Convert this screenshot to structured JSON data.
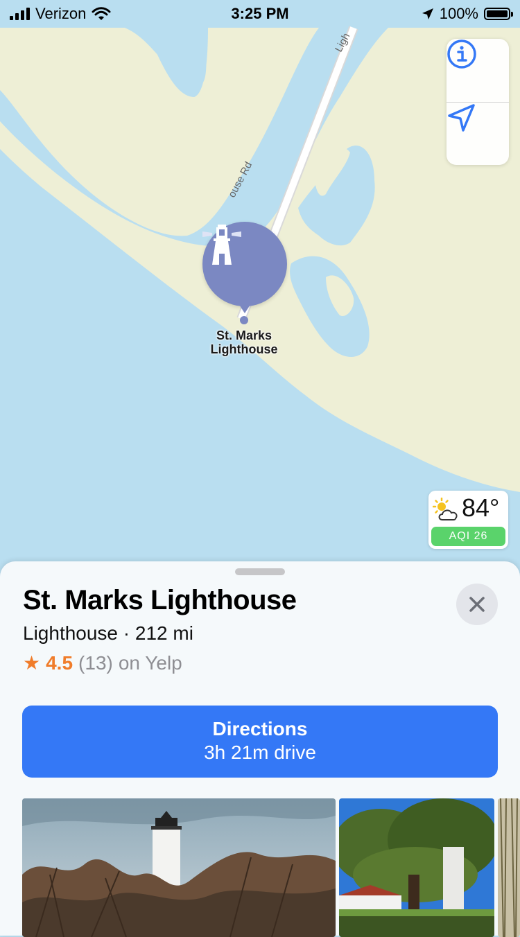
{
  "status_bar": {
    "carrier": "Verizon",
    "time": "3:25 PM",
    "battery_percent": "100%",
    "battery_level": 1.0
  },
  "map": {
    "road_label": "ouse Rd",
    "road_label_top": "Ligh",
    "pin": {
      "label_line1": "St. Marks",
      "label_line2": "Lighthouse",
      "icon": "lighthouse-icon",
      "color": "#7b88c2"
    },
    "controls": {
      "info_icon": "info-icon",
      "location_icon": "location-arrow-icon"
    },
    "weather": {
      "temperature": "84°",
      "aqi": "AQI 26",
      "icon": "partly-sunny-icon",
      "aqi_color": "#5ad36b"
    }
  },
  "place_card": {
    "title": "St. Marks Lighthouse",
    "subtitle": "Lighthouse · 212 mi",
    "rating_score": "4.5",
    "rating_count": "(13)",
    "rating_source": "on Yelp",
    "directions_label": "Directions",
    "directions_time": "3h 21m drive",
    "accent_color": "#3478f6",
    "rating_color": "#f07c2a"
  }
}
